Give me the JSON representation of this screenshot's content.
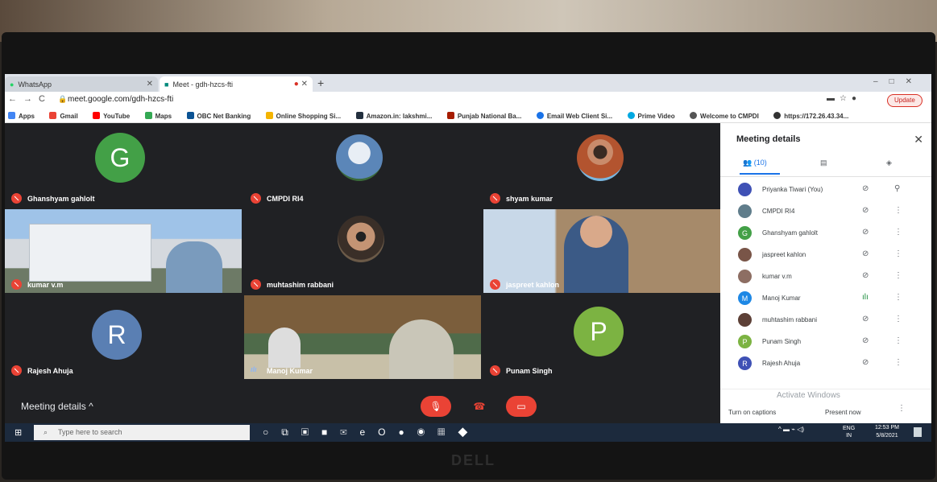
{
  "browser": {
    "tabs": [
      {
        "label": "WhatsApp",
        "icon": "whatsapp-icon"
      },
      {
        "label": "Meet - gdh-hzcs-fti",
        "icon": "meet-icon"
      }
    ],
    "url": "meet.google.com/gdh-hzcs-fti",
    "update_label": "Update",
    "bookmarks": [
      {
        "label": "Apps",
        "color": "#4285f4"
      },
      {
        "label": "Gmail",
        "color": "#ea4335"
      },
      {
        "label": "YouTube",
        "color": "#ff0000"
      },
      {
        "label": "Maps",
        "color": "#34a853"
      },
      {
        "label": "OBC Net Banking",
        "color": "#0b5394"
      },
      {
        "label": "Online Shopping Si...",
        "color": "#f4b400"
      },
      {
        "label": "Amazon.in: lakshmi...",
        "color": "#232f3e"
      },
      {
        "label": "Punjab National Ba...",
        "color": "#a61c00"
      },
      {
        "label": "Email Web Client Si...",
        "color": "#1a73e8"
      },
      {
        "label": "Prime Video",
        "color": "#00a8e1"
      },
      {
        "label": "Welcome to CMPDI",
        "color": "#555555"
      },
      {
        "label": "https://172.26.43.34...",
        "color": "#333333"
      }
    ]
  },
  "meet": {
    "tiles": [
      {
        "name": "Ghanshyam gahlolt",
        "letter": "G",
        "color": "#43a047"
      },
      {
        "name": "CMPDI RI4",
        "letter": "",
        "color": "#5b86b8"
      },
      {
        "name": "shyam kumar",
        "letter": "",
        "color": "#b3542f"
      },
      {
        "name": "kumar v.m",
        "letter": "",
        "color": "#8da0b8"
      },
      {
        "name": "muhtashim rabbani",
        "letter": "",
        "color": "#6b5a48"
      },
      {
        "name": "jaspreet kahlon",
        "letter": "",
        "color": "#4a6a98"
      },
      {
        "name": "Rajesh Ahuja",
        "letter": "R",
        "color": "#5a7fb3"
      },
      {
        "name": "Manoj Kumar",
        "letter": "",
        "color": "#8a6b4d"
      },
      {
        "name": "Punam Singh",
        "letter": "P",
        "color": "#7cb342"
      }
    ],
    "meeting_details_label": "Meeting details"
  },
  "panel": {
    "title": "Meeting details",
    "people_tab": "(10)",
    "participants": [
      {
        "name": "Priyanka Tiwari (You)",
        "initial": "",
        "color": "#3f51b5"
      },
      {
        "name": "CMPDI RI4",
        "initial": "",
        "color": "#607d8b"
      },
      {
        "name": "Ghanshyam gahlolt",
        "initial": "G",
        "color": "#43a047"
      },
      {
        "name": "jaspreet kahlon",
        "initial": "",
        "color": "#795548"
      },
      {
        "name": "kumar v.m",
        "initial": "",
        "color": "#8d6e63"
      },
      {
        "name": "Manoj Kumar",
        "initial": "M",
        "color": "#1e88e5"
      },
      {
        "name": "muhtashim rabbani",
        "initial": "",
        "color": "#5d4037"
      },
      {
        "name": "Punam Singh",
        "initial": "P",
        "color": "#7cb342"
      },
      {
        "name": "Rajesh Ahuja",
        "initial": "R",
        "color": "#3f51b5"
      }
    ],
    "activate": "Activate Windows",
    "captions_label": "Turn on captions",
    "present_label": "Present now"
  },
  "taskbar": {
    "search_placeholder": "Type here to search",
    "lang_top": "ENG",
    "lang_bottom": "IN",
    "time": "12:53 PM",
    "date": "5/8/2021"
  },
  "device_brand": "DELL"
}
